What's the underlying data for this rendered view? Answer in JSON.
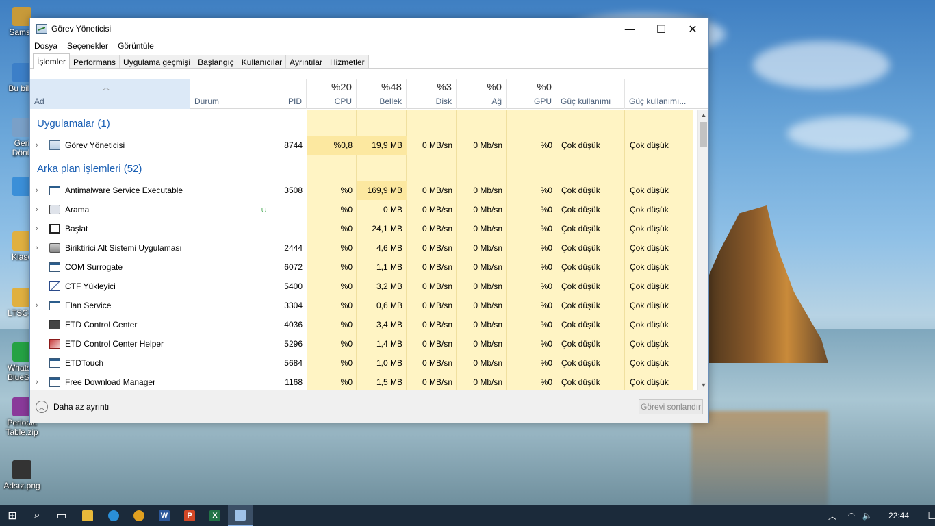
{
  "desktop": {
    "icons": [
      {
        "label": "Samsu",
        "color": "#c79a3a"
      },
      {
        "label": "Bu bilgi",
        "color": "#3c7fc8"
      },
      {
        "label": "Geri\nDönü",
        "color": "#7aa0c8"
      },
      {
        "label": "",
        "color": "#3b8fd8"
      },
      {
        "label": "Klasö",
        "color": "#e0b040"
      },
      {
        "label": "LTSC-A",
        "color": "#e0b040"
      },
      {
        "label": "WhatsA\nBlueSta",
        "color": "#25a244"
      },
      {
        "label": "Periodic\nTable.zip",
        "color": "#8a3a9a"
      },
      {
        "label": "Adsız.png",
        "color": "#333333"
      }
    ]
  },
  "window": {
    "title": "Görev Yöneticisi",
    "controls": {
      "minimize": "—",
      "maximize": "☐",
      "close": "✕"
    },
    "menu": [
      "Dosya",
      "Seçenekler",
      "Görüntüle"
    ],
    "tabs": [
      "İşlemler",
      "Performans",
      "Uygulama geçmişi",
      "Başlangıç",
      "Kullanıcılar",
      "Ayrıntılar",
      "Hizmetler"
    ],
    "active_tab": "İşlemler"
  },
  "columns": {
    "name": {
      "label": "Ad"
    },
    "status": {
      "label": "Durum"
    },
    "pid": {
      "label": "PID"
    },
    "cpu": {
      "pct": "%20",
      "label": "CPU"
    },
    "memory": {
      "pct": "%48",
      "label": "Bellek"
    },
    "disk": {
      "pct": "%3",
      "label": "Disk"
    },
    "network": {
      "pct": "%0",
      "label": "Ağ"
    },
    "gpu": {
      "pct": "%0",
      "label": "GPU"
    },
    "power": {
      "label": "Güç kullanımı"
    },
    "power_trend": {
      "label": "Güç kullanımı..."
    }
  },
  "groups": {
    "apps": "Uygulamalar (1)",
    "background": "Arka plan işlemleri (52)"
  },
  "rows": [
    {
      "name": "Görev Yöneticisi",
      "expand": true,
      "pid": "8744",
      "cpu": "%0,8",
      "mem": "19,9 MB",
      "disk": "0 MB/sn",
      "net": "0 Mb/sn",
      "gpu": "%0",
      "power": "Çok düşük",
      "trend": "Çok düşük",
      "icon": "taskmgr"
    },
    {
      "name": "Antimalware Service Executable",
      "expand": true,
      "pid": "3508",
      "cpu": "%0",
      "mem": "169,9 MB",
      "disk": "0 MB/sn",
      "net": "0 Mb/sn",
      "gpu": "%0",
      "power": "Çok düşük",
      "trend": "Çok düşük",
      "icon": "window"
    },
    {
      "name": "Arama",
      "expand": true,
      "pid": "",
      "status_icon": "leaf",
      "cpu": "%0",
      "mem": "0 MB",
      "disk": "0 MB/sn",
      "net": "0 Mb/sn",
      "gpu": "%0",
      "power": "Çok düşük",
      "trend": "Çok düşük",
      "icon": "search"
    },
    {
      "name": "Başlat",
      "expand": true,
      "pid": "",
      "cpu": "%0",
      "mem": "24,1 MB",
      "disk": "0 MB/sn",
      "net": "0 Mb/sn",
      "gpu": "%0",
      "power": "Çok düşük",
      "trend": "Çok düşük",
      "icon": "start"
    },
    {
      "name": "Biriktirici Alt Sistemi Uygulaması",
      "expand": true,
      "pid": "2444",
      "cpu": "%0",
      "mem": "4,6 MB",
      "disk": "0 MB/sn",
      "net": "0 Mb/sn",
      "gpu": "%0",
      "power": "Çok düşük",
      "trend": "Çok düşük",
      "icon": "printer"
    },
    {
      "name": "COM Surrogate",
      "expand": false,
      "pid": "6072",
      "cpu": "%0",
      "mem": "1,1 MB",
      "disk": "0 MB/sn",
      "net": "0 Mb/sn",
      "gpu": "%0",
      "power": "Çok düşük",
      "trend": "Çok düşük",
      "icon": "window"
    },
    {
      "name": "CTF Yükleyici",
      "expand": false,
      "pid": "5400",
      "cpu": "%0",
      "mem": "3,2 MB",
      "disk": "0 MB/sn",
      "net": "0 Mb/sn",
      "gpu": "%0",
      "power": "Çok düşük",
      "trend": "Çok düşük",
      "icon": "pen"
    },
    {
      "name": "Elan Service",
      "expand": true,
      "pid": "3304",
      "cpu": "%0",
      "mem": "0,6 MB",
      "disk": "0 MB/sn",
      "net": "0 Mb/sn",
      "gpu": "%0",
      "power": "Çok düşük",
      "trend": "Çok düşük",
      "icon": "window"
    },
    {
      "name": "ETD Control Center",
      "expand": false,
      "pid": "4036",
      "cpu": "%0",
      "mem": "3,4 MB",
      "disk": "0 MB/sn",
      "net": "0 Mb/sn",
      "gpu": "%0",
      "power": "Çok düşük",
      "trend": "Çok düşük",
      "icon": "monitor"
    },
    {
      "name": "ETD Control Center Helper",
      "expand": false,
      "pid": "5296",
      "cpu": "%0",
      "mem": "1,4 MB",
      "disk": "0 MB/sn",
      "net": "0 Mb/sn",
      "gpu": "%0",
      "power": "Çok düşük",
      "trend": "Çok düşük",
      "icon": "helper"
    },
    {
      "name": "ETDTouch",
      "expand": false,
      "pid": "5684",
      "cpu": "%0",
      "mem": "1,0 MB",
      "disk": "0 MB/sn",
      "net": "0 Mb/sn",
      "gpu": "%0",
      "power": "Çok düşük",
      "trend": "Çok düşük",
      "icon": "window"
    },
    {
      "name": "Free Download Manager",
      "expand": true,
      "pid": "1168",
      "cpu": "%0",
      "mem": "1,5 MB",
      "disk": "0 MB/sn",
      "net": "0 Mb/sn",
      "gpu": "%0",
      "power": "Çok düşük",
      "trend": "Çok düşük",
      "icon": "window"
    }
  ],
  "footer": {
    "fewer_details": "Daha az ayrıntı",
    "end_task": "Görevi sonlandır"
  },
  "taskbar": {
    "apps": [
      {
        "name": "start-icon",
        "glyph": "⊞",
        "color": "#ffffff"
      },
      {
        "name": "search-icon",
        "glyph": "⌕",
        "color": "#ffffff"
      },
      {
        "name": "task-view-icon",
        "glyph": "▭",
        "color": "#ffffff"
      },
      {
        "name": "file-explorer-icon",
        "glyph": "",
        "color": "#e8b93a"
      },
      {
        "name": "edge-icon",
        "glyph": "",
        "color": "#2a8fd8"
      },
      {
        "name": "chrome-icon",
        "glyph": "",
        "color": "#e0a020"
      },
      {
        "name": "word-icon",
        "glyph": "W",
        "color": "#2b579a"
      },
      {
        "name": "powerpoint-icon",
        "glyph": "P",
        "color": "#d24726"
      },
      {
        "name": "excel-icon",
        "glyph": "X",
        "color": "#217346"
      },
      {
        "name": "task-manager-icon",
        "glyph": "",
        "color": "#9fc2e8"
      }
    ],
    "tray": {
      "chevron": "︿",
      "wifi": "◠",
      "volume": "🔈",
      "time": "22:44",
      "notifications": "☐"
    }
  }
}
